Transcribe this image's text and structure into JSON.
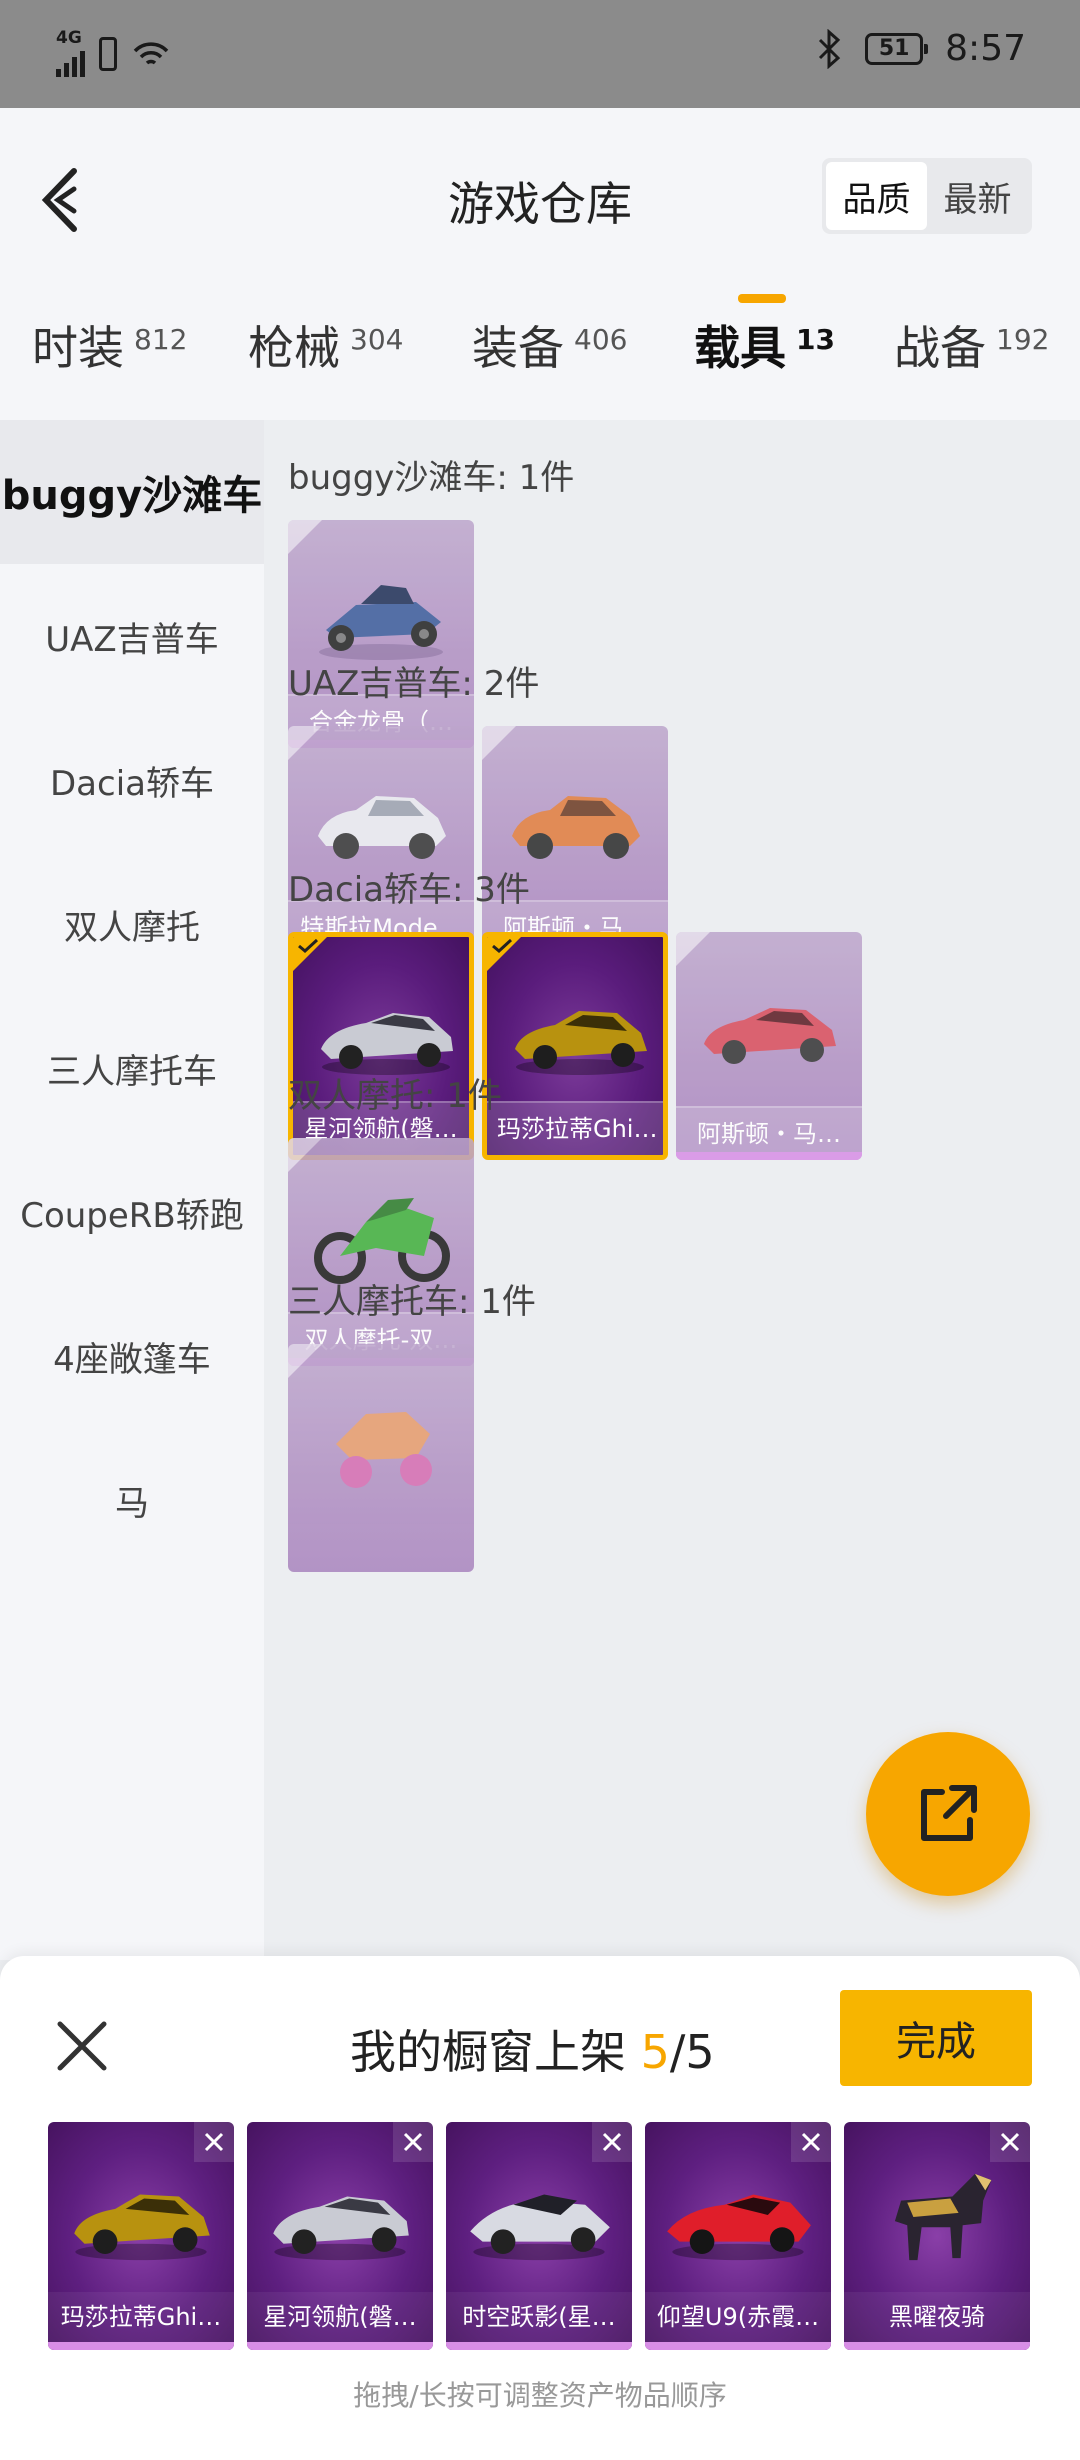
{
  "status_bar": {
    "network": "4G",
    "time": "8:57",
    "battery": "51"
  },
  "header": {
    "title": "游戏仓库",
    "sort_options": [
      "品质",
      "最新"
    ]
  },
  "tabs": [
    {
      "label": "时装",
      "count": "812"
    },
    {
      "label": "枪械",
      "count": "304"
    },
    {
      "label": "装备",
      "count": "406"
    },
    {
      "label": "载具",
      "count": "13"
    },
    {
      "label": "战备",
      "count": "192"
    }
  ],
  "sidebar": {
    "items": [
      "buggy沙滩车",
      "UAZ吉普车",
      "Dacia轿车",
      "双人摩托",
      "三人摩托车",
      "CoupeRB轿跑",
      "4座敞篷车",
      "马"
    ]
  },
  "sections": [
    {
      "title": "buggy沙滩车: 1件",
      "items": [
        {
          "name": "合金龙骨（…",
          "icon": "buggy-icon",
          "selected": false
        }
      ]
    },
    {
      "title": "UAZ吉普车: 2件",
      "items": [
        {
          "name": "特斯拉Mode…",
          "icon": "white-suv-icon",
          "selected": false
        },
        {
          "name": "阿斯顿・马…",
          "icon": "orange-suv-icon",
          "selected": false
        }
      ]
    },
    {
      "title": "Dacia轿车: 3件",
      "items": [
        {
          "name": "星河领航(磐…",
          "icon": "silver-sports-car-icon",
          "selected": true
        },
        {
          "name": "玛莎拉蒂Ghi…",
          "icon": "gold-sedan-icon",
          "selected": true
        },
        {
          "name": "阿斯顿・马…",
          "icon": "red-coupe-icon",
          "selected": false
        }
      ]
    },
    {
      "title": "双人摩托: 1件",
      "items": [
        {
          "name": "双人摩托-双…",
          "icon": "green-motorbike-icon",
          "selected": false
        }
      ]
    },
    {
      "title": "三人摩托车: 1件",
      "items": [
        {
          "name": "",
          "icon": "trike-icon",
          "selected": false
        }
      ]
    }
  ],
  "showcase": {
    "title_prefix": "我的橱窗上架 ",
    "current": "5",
    "total": "/5",
    "done_label": "完成",
    "hint": "拖拽/长按可调整资产物品顺序",
    "items": [
      {
        "name": "玛莎拉蒂Ghi…",
        "icon": "gold-sedan-icon"
      },
      {
        "name": "星河领航(磐…",
        "icon": "silver-sports-car-icon"
      },
      {
        "name": "时空跃影(星…",
        "icon": "concept-car-icon"
      },
      {
        "name": "仰望U9(赤霞…",
        "icon": "red-supercar-icon"
      },
      {
        "name": "黑曜夜骑",
        "icon": "armored-horse-icon"
      }
    ]
  },
  "colors": {
    "accent": "#f7a600",
    "selected_border": "#f7b500",
    "card_purple": "#5a1c7c",
    "sidebar_bg": "#f5f6f9"
  }
}
